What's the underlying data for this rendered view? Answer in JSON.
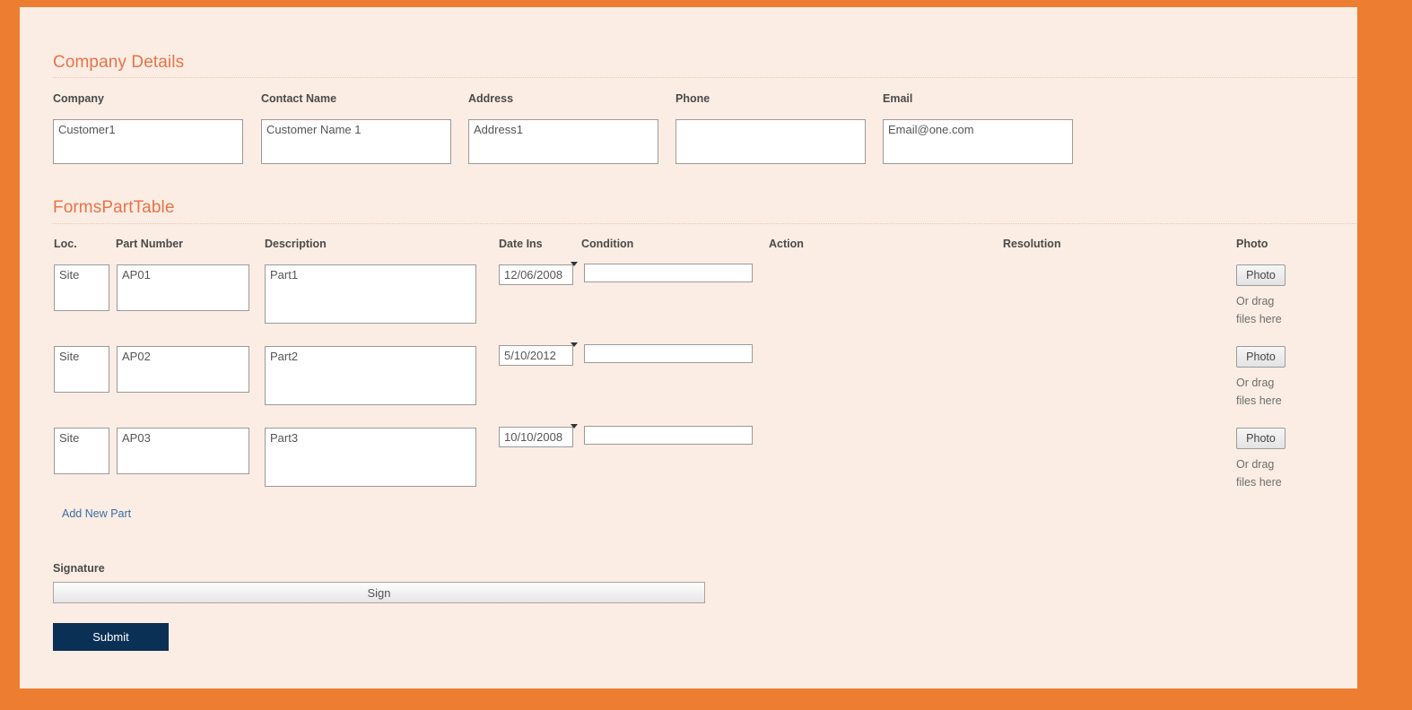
{
  "theme": {
    "page_border_color": "#ED7D31",
    "panel_background": "#FBEDE3",
    "heading_color": "#E8734A",
    "link_color": "#3A6EA5",
    "submit_color": "#0B3055"
  },
  "company_section": {
    "heading": "Company Details",
    "fields": [
      {
        "label": "Company",
        "value": "Customer1",
        "placeholder": ""
      },
      {
        "label": "Contact Name",
        "value": "Customer Name 1",
        "placeholder": ""
      },
      {
        "label": "Address",
        "value": "Address1",
        "placeholder": ""
      },
      {
        "label": "Phone",
        "value": "",
        "placeholder": ""
      },
      {
        "label": "Email",
        "value": "Email@one.com",
        "placeholder": ""
      }
    ]
  },
  "parts_section": {
    "heading": "FormsPartTable",
    "columns": [
      "Loc.",
      "Part Number",
      "Description",
      "Date Ins",
      "Condition",
      "Action",
      "Resolution",
      "Photo"
    ],
    "rows": [
      {
        "loc": "Site",
        "part_number": "AP01",
        "description": "Part1",
        "date_ins": "12/06/2008",
        "condition": "",
        "action": "",
        "resolution": "",
        "photo_button": "Photo",
        "drag_text": "Or drag files here"
      },
      {
        "loc": "Site",
        "part_number": "AP02",
        "description": "Part2",
        "date_ins": "5/10/2012",
        "condition": "",
        "action": "",
        "resolution": "",
        "photo_button": "Photo",
        "drag_text": "Or drag files here"
      },
      {
        "loc": "Site",
        "part_number": "AP03",
        "description": "Part3",
        "date_ins": "10/10/2008",
        "condition": "",
        "action": "",
        "resolution": "",
        "photo_button": "Photo",
        "drag_text": "Or drag files here"
      }
    ],
    "condition_options": [
      ""
    ],
    "add_new_part_label": "Add New Part"
  },
  "signature_section": {
    "label": "Signature",
    "sign_button": "Sign"
  },
  "footer": {
    "submit_label": "Submit"
  }
}
